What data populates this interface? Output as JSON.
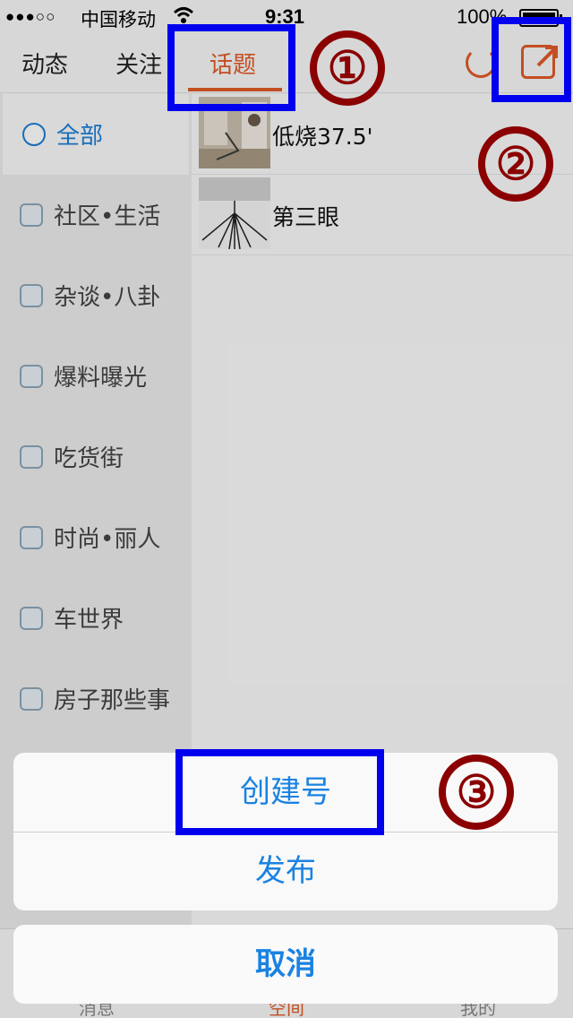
{
  "status_bar": {
    "signal": "●●●○○",
    "carrier": "中国移动",
    "time": "9:31",
    "battery": "100%"
  },
  "top_nav": {
    "tabs": [
      "动态",
      "关注",
      "话题"
    ],
    "active_tab": "话题"
  },
  "sidebar": {
    "items": [
      {
        "label": "全部",
        "icon": "chat-bubble-icon",
        "active": true
      },
      {
        "label": "社区•生活",
        "icon": "community-icon"
      },
      {
        "label": "杂谈•八卦",
        "icon": "gossip-icon"
      },
      {
        "label": "爆料曝光",
        "icon": "expose-icon"
      },
      {
        "label": "吃货街",
        "icon": "food-icon"
      },
      {
        "label": "时尚•丽人",
        "icon": "fashion-icon"
      },
      {
        "label": "车世界",
        "icon": "car-icon"
      },
      {
        "label": "房子那些事",
        "icon": "house-icon"
      }
    ]
  },
  "topics": [
    {
      "name": "低烧37.5'"
    },
    {
      "name": "第三眼"
    }
  ],
  "tab_bar": {
    "items": [
      "消息",
      "空间",
      "我的"
    ]
  },
  "action_sheet": {
    "create": "创建号",
    "publish": "发布",
    "cancel": "取消"
  },
  "annotations": {
    "one": "①",
    "two": "②",
    "three": "③"
  },
  "colors": {
    "accent": "#e05a28",
    "link_blue": "#1a82e2",
    "highlight_box": "#0000ee",
    "annotation_red": "#8b0000"
  }
}
